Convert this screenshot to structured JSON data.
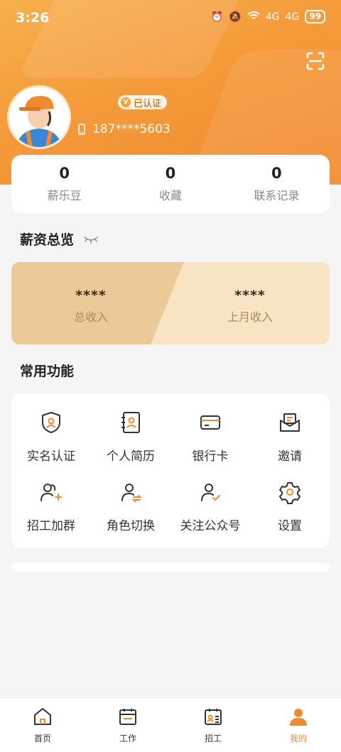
{
  "status_bar": {
    "time": "3:26",
    "signal1": "4G",
    "signal2": "4G",
    "battery": "99"
  },
  "profile": {
    "verified_label": "已认证",
    "phone": "187****5603"
  },
  "stats": [
    {
      "value": "0",
      "label": "薪乐豆"
    },
    {
      "value": "0",
      "label": "收藏"
    },
    {
      "value": "0",
      "label": "联系记录"
    }
  ],
  "salary": {
    "title": "薪资总览",
    "total": {
      "value": "****",
      "label": "总收入"
    },
    "last_month": {
      "value": "****",
      "label": "上月收入"
    }
  },
  "functions": {
    "title": "常用功能",
    "items": [
      {
        "label": "实名认证",
        "icon": "shield-user-icon"
      },
      {
        "label": "个人简历",
        "icon": "contact-book-icon"
      },
      {
        "label": "银行卡",
        "icon": "bank-card-icon"
      },
      {
        "label": "邀请",
        "icon": "invite-mail-icon"
      },
      {
        "label": "招工加群",
        "icon": "group-add-icon"
      },
      {
        "label": "角色切换",
        "icon": "role-switch-icon"
      },
      {
        "label": "关注公众号",
        "icon": "follow-user-icon"
      },
      {
        "label": "设置",
        "icon": "gear-icon"
      }
    ]
  },
  "tabbar": [
    {
      "label": "首页",
      "icon": "home-icon"
    },
    {
      "label": "工作",
      "icon": "calendar-icon"
    },
    {
      "label": "招工",
      "icon": "recruit-board-icon"
    },
    {
      "label": "我的",
      "icon": "person-icon"
    }
  ],
  "colors": {
    "accent": "#f08a30",
    "header_start": "#f7b04d",
    "salary_left": "#ecc998",
    "salary_right": "#f8e3c3"
  }
}
